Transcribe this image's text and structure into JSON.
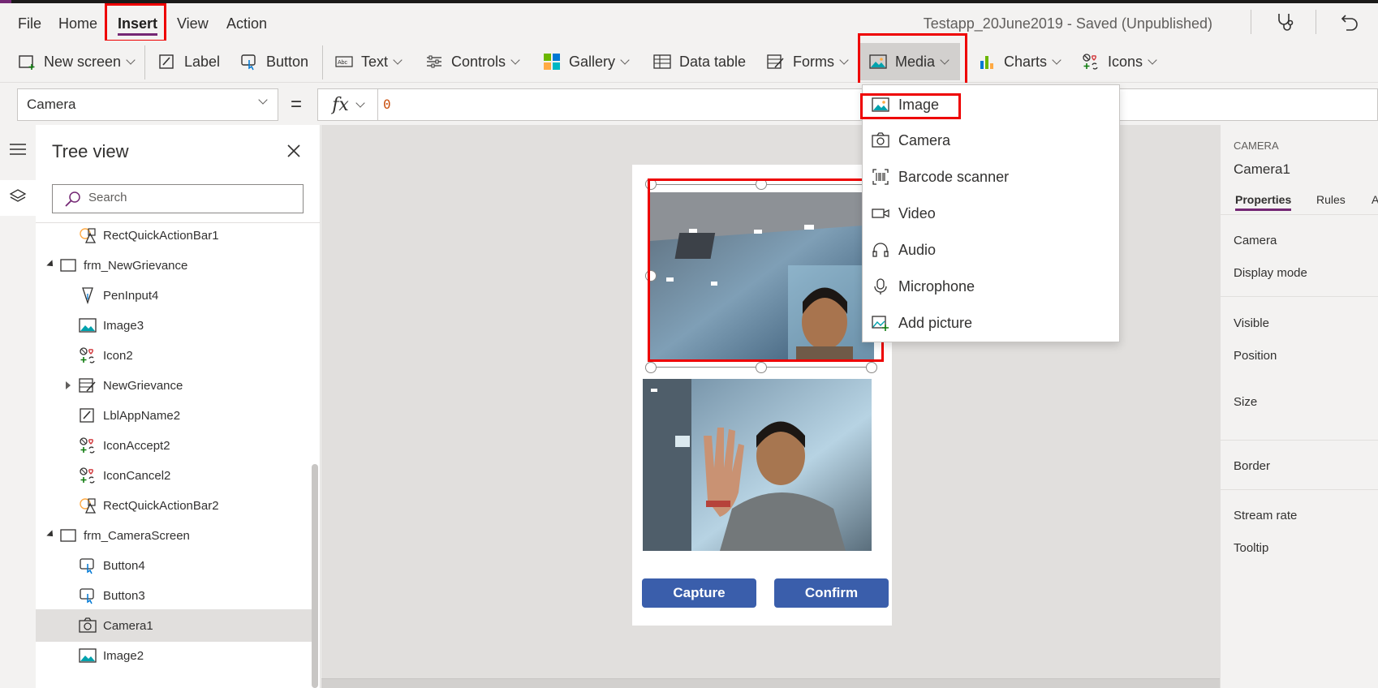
{
  "menubar": {
    "items": [
      {
        "label": "File"
      },
      {
        "label": "Home"
      },
      {
        "label": "Insert"
      },
      {
        "label": "View"
      },
      {
        "label": "Action"
      }
    ],
    "status": "Testapp_20June2019 - Saved (Unpublished)"
  },
  "ribbon": {
    "new_screen": "New screen",
    "label": "Label",
    "button": "Button",
    "text": "Text",
    "controls": "Controls",
    "gallery": "Gallery",
    "data_table": "Data table",
    "forms": "Forms",
    "media": "Media",
    "charts": "Charts",
    "icons": "Icons"
  },
  "formula": {
    "property": "Camera",
    "equals": "=",
    "fx": "fx",
    "value": "0"
  },
  "media_menu": {
    "items": [
      {
        "label": "Image",
        "icon": "image-icon"
      },
      {
        "label": "Camera",
        "icon": "camera-icon"
      },
      {
        "label": "Barcode scanner",
        "icon": "barcode-icon"
      },
      {
        "label": "Video",
        "icon": "video-icon"
      },
      {
        "label": "Audio",
        "icon": "headphones-icon"
      },
      {
        "label": "Microphone",
        "icon": "microphone-icon"
      },
      {
        "label": "Add picture",
        "icon": "add-picture-icon"
      }
    ]
  },
  "tree": {
    "title": "Tree view",
    "search_placeholder": "Search",
    "items": [
      {
        "label": "RectQuickActionBar1",
        "icon": "shapes-icon",
        "level": 2
      },
      {
        "label": "frm_NewGrievance",
        "icon": "screen-icon",
        "level": 1
      },
      {
        "label": "PenInput4",
        "icon": "pen-icon",
        "level": 2
      },
      {
        "label": "Image3",
        "icon": "image-icon",
        "level": 2
      },
      {
        "label": "Icon2",
        "icon": "icons-icon",
        "level": 2
      },
      {
        "label": "NewGrievance",
        "icon": "form-icon",
        "level": 2
      },
      {
        "label": "LblAppName2",
        "icon": "label-icon",
        "level": 2
      },
      {
        "label": "IconAccept2",
        "icon": "icons-icon",
        "level": 2
      },
      {
        "label": "IconCancel2",
        "icon": "icons-icon",
        "level": 2
      },
      {
        "label": "RectQuickActionBar2",
        "icon": "shapes-icon",
        "level": 2
      },
      {
        "label": "frm_CameraScreen",
        "icon": "screen-icon",
        "level": 1
      },
      {
        "label": "Button4",
        "icon": "button-icon",
        "level": 2
      },
      {
        "label": "Button3",
        "icon": "button-icon",
        "level": 2
      },
      {
        "label": "Camera1",
        "icon": "camera-icon",
        "level": 2
      },
      {
        "label": "Image2",
        "icon": "image-icon",
        "level": 2
      }
    ]
  },
  "canvas": {
    "capture_label": "Capture",
    "confirm_label": "Confirm"
  },
  "props": {
    "type": "CAMERA",
    "name": "Camera1",
    "tabs": [
      "Properties",
      "Rules",
      "A"
    ],
    "rows": [
      "Camera",
      "Display mode",
      "Visible",
      "Position",
      "Size",
      "Border",
      "Stream rate",
      "Tooltip"
    ]
  },
  "colors": {
    "accent": "#742774",
    "button_blue": "#3a5eab",
    "highlight_red": "#e00000"
  }
}
